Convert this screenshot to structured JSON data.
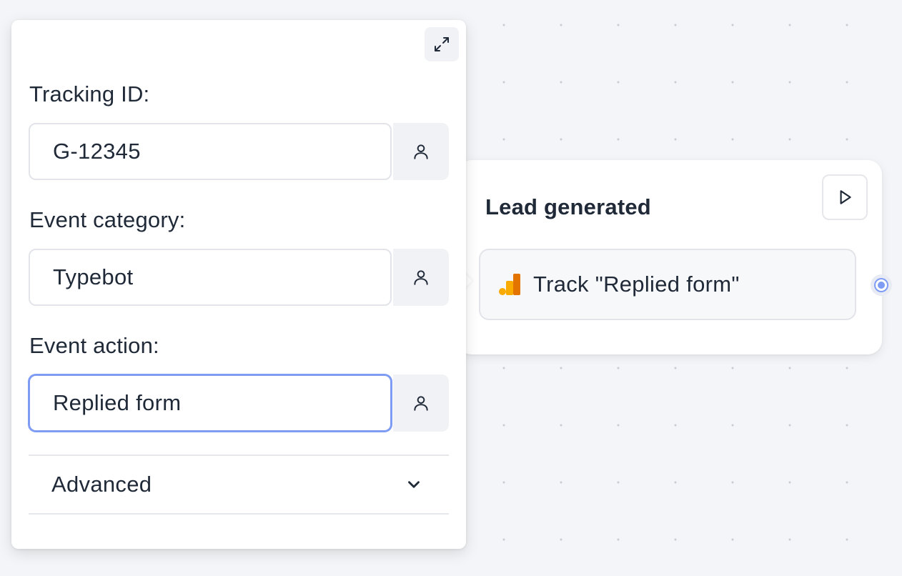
{
  "canvas": {
    "background": "#f4f5f8",
    "dot_color": "#c7cbd3"
  },
  "group": {
    "title": "Lead generated",
    "play_icon": "play-icon",
    "block": {
      "icon": "google-analytics-icon",
      "label": "Track \"Replied form\""
    }
  },
  "settings": {
    "expand_icon": "expand-icon",
    "tracking_id": {
      "label": "Tracking ID:",
      "value": "G-12345",
      "variable_icon": "user-icon"
    },
    "event_category": {
      "label": "Event category:",
      "value": "Typebot",
      "variable_icon": "user-icon"
    },
    "event_action": {
      "label": "Event action:",
      "value": "Replied form",
      "variable_icon": "user-icon",
      "focused": true
    },
    "advanced": {
      "label": "Advanced",
      "icon": "chevron-down-icon",
      "expanded": false
    }
  },
  "colors": {
    "accent": "#7f9cf5",
    "text": "#1f2937",
    "ga_orange": "#f9ab00",
    "ga_dark_orange": "#e37400"
  }
}
